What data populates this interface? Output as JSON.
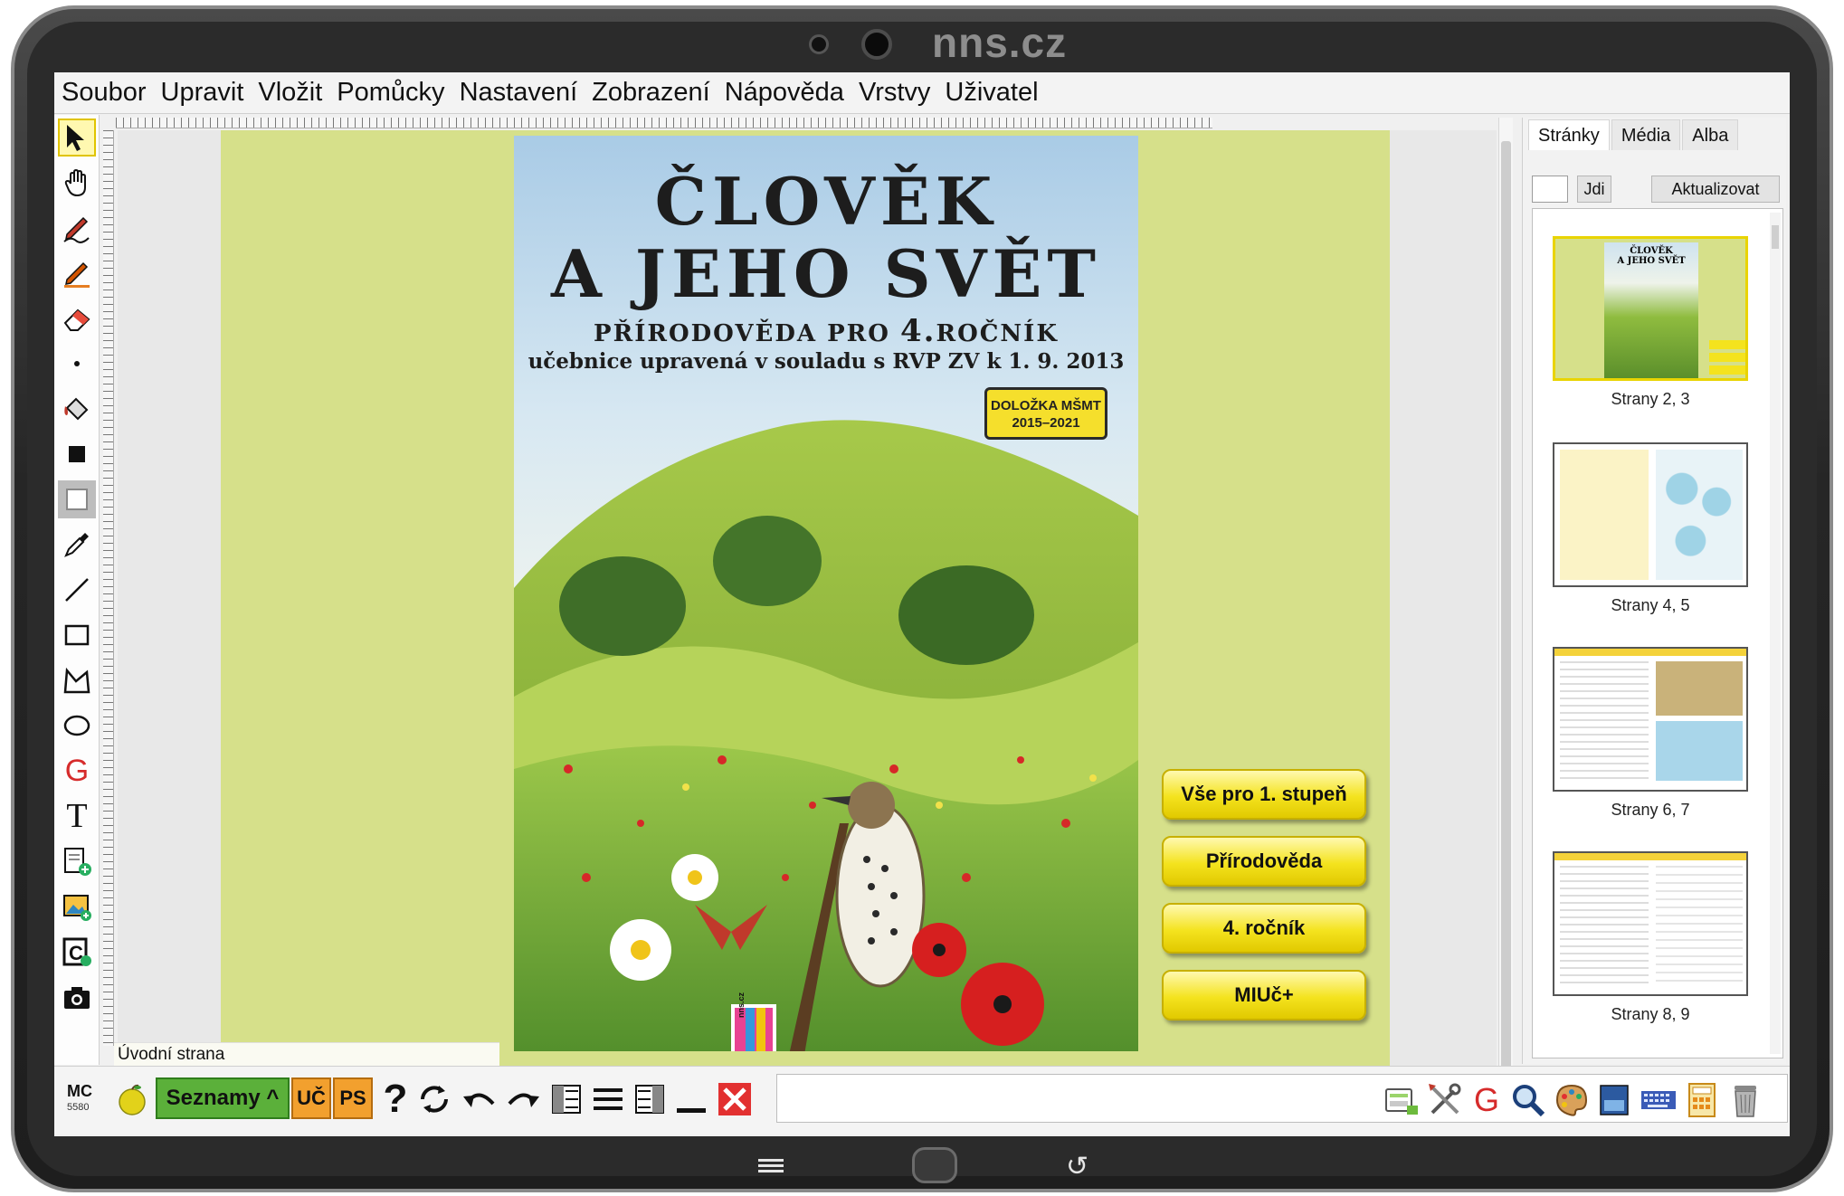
{
  "device": {
    "brand": "nns.cz"
  },
  "menu": [
    "Soubor",
    "Upravit",
    "Vložit",
    "Pomůcky",
    "Nastavení",
    "Zobrazení",
    "Nápověda",
    "Vrstvy",
    "Uživatel"
  ],
  "tools": [
    "pointer-icon",
    "hand-icon",
    "pen-icon",
    "marker-icon",
    "eraser-icon",
    "dot-icon",
    "fill-icon",
    "filled-rect-icon",
    "fill-outline-icon",
    "eyedropper-icon",
    "line-icon",
    "rectangle-icon",
    "polygon-icon",
    "ellipse-icon",
    "geogebra-icon",
    "text-icon",
    "add-page-icon",
    "add-image-icon",
    "add-card-icon",
    "camera-icon"
  ],
  "page": {
    "label": "Úvodní strana"
  },
  "cover": {
    "title_line1": "ČLOVĚK",
    "title_line2": "A JEHO SVĚT",
    "subtitle_a": "PŘÍRODOVĚDA PRO ",
    "subtitle_num": "4.",
    "subtitle_b": "ROČNÍK",
    "subtitle2": "učebnice upravená v souladu s RVP ZV k 1. 9. 2013",
    "badge_line1": "DOLOŽKA MŠMT",
    "badge_line2": "2015–2021",
    "logo_text": "nns.cz"
  },
  "nav_buttons": [
    "Vše pro 1. stupeň",
    "Přírodověda",
    "4. ročník",
    "MIUč+"
  ],
  "panel": {
    "tabs": [
      "Stránky",
      "Média",
      "Alba"
    ],
    "goto_label": "Jdi",
    "refresh_label": "Aktualizovat",
    "thumbnails": [
      {
        "caption": "Strany 2, 3"
      },
      {
        "caption": "Strany 4, 5"
      },
      {
        "caption": "Strany 6, 7"
      },
      {
        "caption": "Strany 8, 9"
      }
    ],
    "thumb_cover_title1": "ČLOVĚK",
    "thumb_cover_title2": "A JEHO SVĚT"
  },
  "bottom": {
    "mc_label": "MC",
    "mc_number": "5580",
    "seznamy_label": "Seznamy ^",
    "uc_label": "UČ",
    "ps_label": "PS",
    "help_label": "?"
  },
  "colors": {
    "accent_yellow": "#f4e31e",
    "page_green": "#d6e08a",
    "seznamy_green": "#5bb03a",
    "uc_orange": "#f2a02e"
  }
}
